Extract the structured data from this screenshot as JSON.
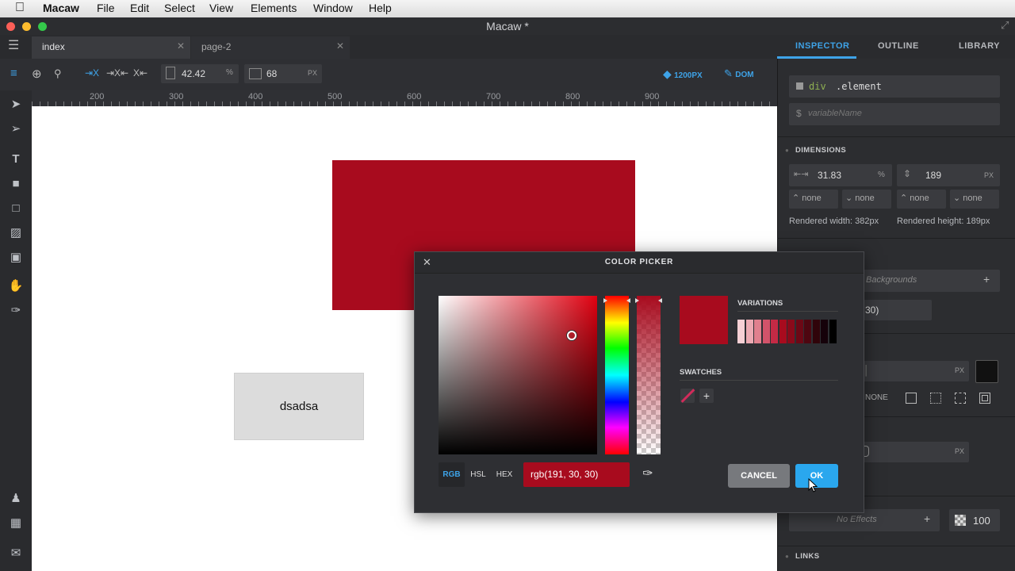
{
  "menubar": {
    "app": "Macaw",
    "items": [
      "File",
      "Edit",
      "Select",
      "View",
      "Elements",
      "Window",
      "Help"
    ]
  },
  "window": {
    "title": "Macaw *"
  },
  "tabs": [
    {
      "label": "index"
    },
    {
      "label": "page-2"
    }
  ],
  "toolbar": {
    "width_value": "42.42",
    "width_unit": "%",
    "height_value": "68",
    "height_unit": "PX",
    "breakpoint": "1200PX",
    "dom": "DOM"
  },
  "ruler": [
    "200",
    "300",
    "400",
    "500",
    "600",
    "700",
    "800",
    "900"
  ],
  "canvas": {
    "red_box_color": "#a80b1e",
    "text_box_label": "dsadsa"
  },
  "inspector": {
    "tabs": [
      "INSPECTOR",
      "OUTLINE",
      "LIBRARY"
    ],
    "element_tag": "div",
    "element_class": ".element",
    "variable_placeholder": "variableName",
    "dimensions_title": "DIMENSIONS",
    "width_value": "31.83",
    "width_unit": "%",
    "height_value": "189",
    "height_unit": "PX",
    "constraints": [
      "none",
      "none",
      "none",
      "none"
    ],
    "rendered_width": "Rendered width: 382px",
    "rendered_height": "Rendered height: 189px",
    "backgrounds": "Backgrounds",
    "bg_value": "30)",
    "px1": "PX",
    "border_none": "NONE",
    "px2": "PX",
    "effects": "No Effects",
    "opacity": "100",
    "links_title": "LINKS"
  },
  "color_picker": {
    "title": "COLOR PICKER",
    "variations_label": "VARIATIONS",
    "swatches_label": "SWATCHES",
    "modes": [
      "RGB",
      "HSL",
      "HEX"
    ],
    "active_mode": "RGB",
    "value": "rgb(191, 30, 30)",
    "current_color": "#a80b1e",
    "variations": [
      "#f6d0d5",
      "#ecaab3",
      "#e0808e",
      "#d2536a",
      "#c42a45",
      "#a80b1e",
      "#8a0a1a",
      "#6c0815",
      "#4e0610",
      "#30040a",
      "#15020a",
      "#000000"
    ],
    "cancel": "CANCEL",
    "ok": "OK"
  }
}
